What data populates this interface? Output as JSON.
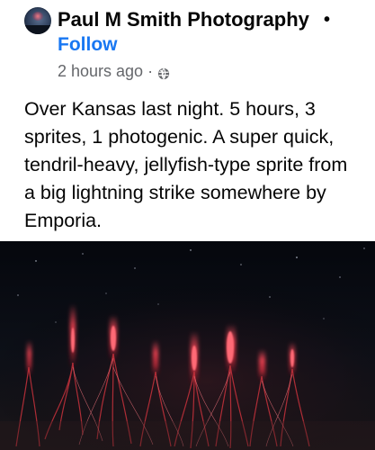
{
  "post": {
    "author": "Paul M Smith Photography",
    "separator": "•",
    "follow_label": "Follow",
    "timestamp": "2 hours ago",
    "meta_separator": "·",
    "audience_icon": "globe-icon",
    "caption": "Over Kansas last night. 5 hours, 3 sprites, 1 photogenic. A super quick, tendril-heavy, jellyfish-type sprite from a big lightning strike somewhere by Emporia."
  },
  "colors": {
    "follow": "#1877f2",
    "meta_text": "#65676b",
    "text": "#050505",
    "photo_sky": "#06080e",
    "sprite_red": "#c8323c"
  }
}
